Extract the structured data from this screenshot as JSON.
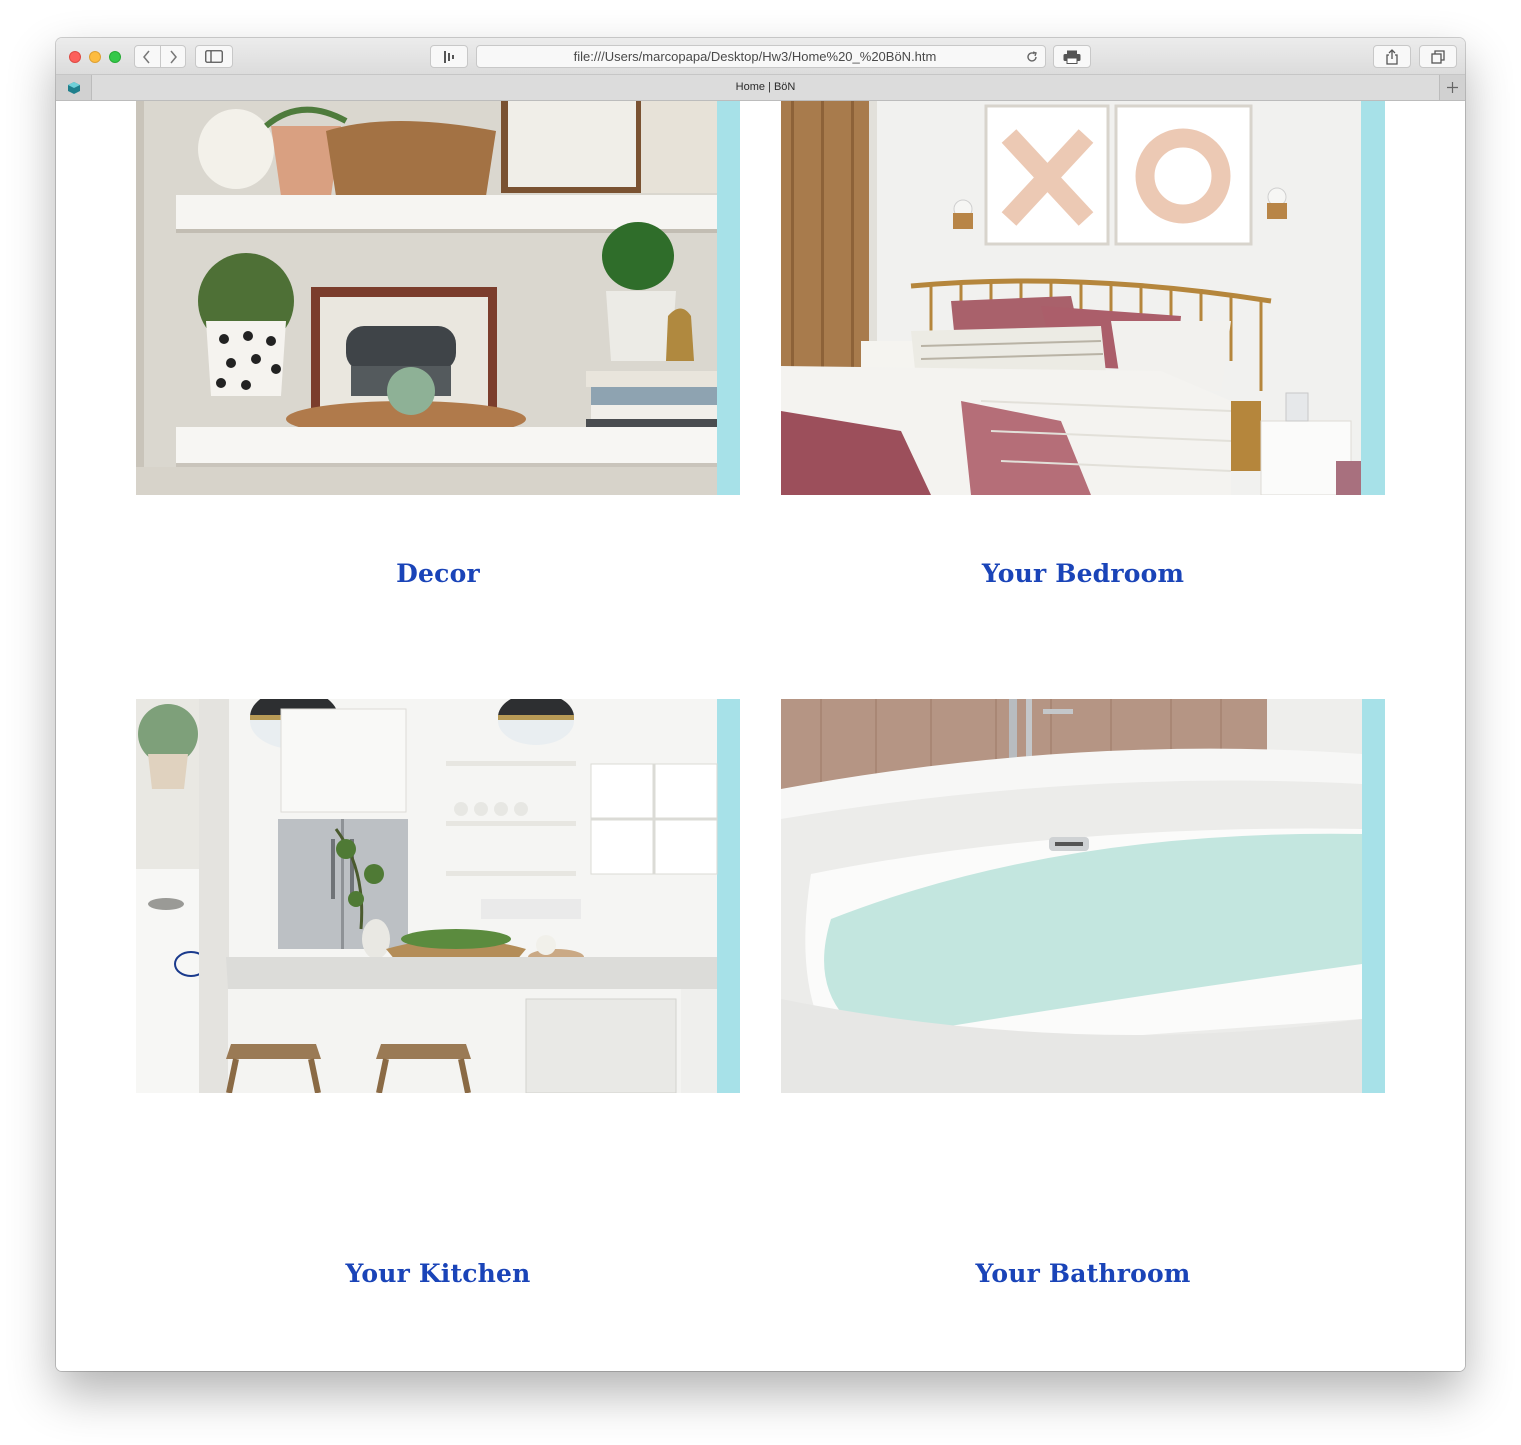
{
  "browser": {
    "url": "file:///Users/marcopapa/Desktop/Hw3/Home%20_%20BöN.htm",
    "tab_title": "Home | BöN",
    "icons": [
      "back-icon",
      "forward-icon",
      "sidebar-icon",
      "reader-icon",
      "reload-icon",
      "print-icon",
      "share-icon",
      "tabs-icon",
      "new-tab-icon"
    ]
  },
  "page": {
    "accent_color": "#a7e1e8",
    "heading_color": "#1a44b8",
    "cards": [
      {
        "label": "Decor",
        "image": "shelves-decor-photo"
      },
      {
        "label": "Your Bedroom",
        "image": "bedroom-photo"
      },
      {
        "label": "Your Kitchen",
        "image": "kitchen-photo"
      },
      {
        "label": "Your Bathroom",
        "image": "bathtub-photo"
      }
    ]
  }
}
